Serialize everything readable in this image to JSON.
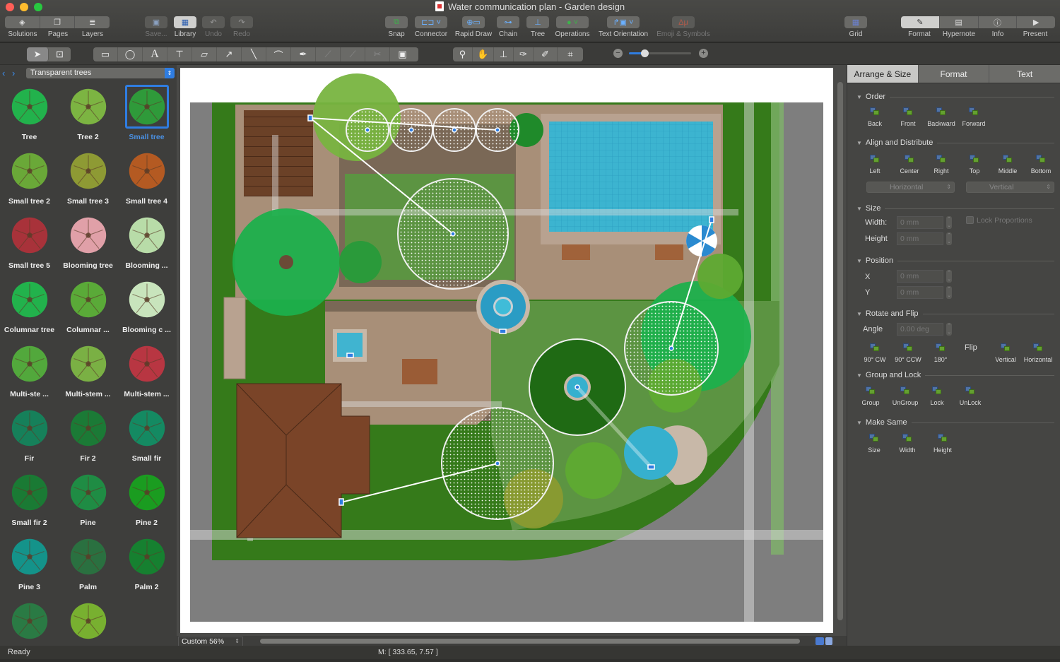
{
  "window": {
    "title": "Water communication plan - Garden design",
    "controls": [
      "close",
      "minimize",
      "zoom"
    ]
  },
  "toolbar": {
    "left_segment": [
      {
        "label": "Solutions",
        "icon": "solutions-icon"
      },
      {
        "label": "Pages",
        "icon": "pages-icon"
      },
      {
        "label": "Layers",
        "icon": "layers-icon"
      }
    ],
    "save": {
      "label": "Save...",
      "enabled": false
    },
    "library": {
      "label": "Library",
      "active": true
    },
    "undo": {
      "label": "Undo",
      "enabled": false
    },
    "redo": {
      "label": "Redo",
      "enabled": false
    },
    "snap": {
      "label": "Snap"
    },
    "connector": {
      "label": "Connector"
    },
    "rapid_draw": {
      "label": "Rapid Draw"
    },
    "chain": {
      "label": "Chain"
    },
    "tree": {
      "label": "Tree"
    },
    "operations": {
      "label": "Operations"
    },
    "text_orientation": {
      "label": "Text Orientation"
    },
    "emoji": {
      "label": "Emoji & Symbols",
      "enabled": false
    },
    "grid": {
      "label": "Grid"
    },
    "right_segment": [
      {
        "label": "Format",
        "icon": "palette-icon",
        "active": true
      },
      {
        "label": "Hypernote",
        "icon": "hypernote-icon"
      },
      {
        "label": "Info",
        "icon": "info-icon"
      },
      {
        "label": "Present",
        "icon": "present-icon"
      }
    ]
  },
  "drawing_tools": {
    "select": [
      "pointer-tool",
      "text-box-select-tool"
    ],
    "shapes": [
      "rectangle-tool",
      "ellipse-tool",
      "text-tool",
      "text-block-tool",
      "callout-tool",
      "arrow-line-tool",
      "line-tool",
      "arc-tool",
      "pen-tool",
      "edit-points-tool",
      "add-point-tool",
      "delete-point-tool",
      "image-tool"
    ],
    "view": [
      "zoom-tool",
      "pan-tool",
      "stamp-tool",
      "eyedropper-tool",
      "format-painter-tool",
      "crop-tool"
    ],
    "zoom_slider_value": 0.25
  },
  "library": {
    "selected": "Transparent trees",
    "items": [
      {
        "label": "Tree",
        "color": "#22b24c"
      },
      {
        "label": "Tree 2",
        "color": "#7cb442"
      },
      {
        "label": "Small tree",
        "color": "#2f9a3a",
        "selected": true
      },
      {
        "label": "Small tree 2",
        "color": "#6aa838"
      },
      {
        "label": "Small tree 3",
        "color": "#8e9a34"
      },
      {
        "label": "Small tree 4",
        "color": "#b45a22"
      },
      {
        "label": "Small tree 5",
        "color": "#a8323a"
      },
      {
        "label": "Blooming tree",
        "color": "#e0a0a8"
      },
      {
        "label": "Blooming ...",
        "color": "#b8dca8"
      },
      {
        "label": "Columnar tree",
        "color": "#22b24c"
      },
      {
        "label": "Columnar ...",
        "color": "#5aaa38"
      },
      {
        "label": "Blooming c ...",
        "color": "#c8e4bc"
      },
      {
        "label": "Multi-ste ...",
        "color": "#52a83c"
      },
      {
        "label": "Multi-stem ...",
        "color": "#7ab044"
      },
      {
        "label": "Multi-stem ...",
        "color": "#b83642"
      },
      {
        "label": "Fir",
        "color": "#16805a"
      },
      {
        "label": "Fir 2",
        "color": "#1b7a36"
      },
      {
        "label": "Small fir",
        "color": "#148a62"
      },
      {
        "label": "Small fir 2",
        "color": "#1a7a34"
      },
      {
        "label": "Pine",
        "color": "#1f8c44"
      },
      {
        "label": "Pine 2",
        "color": "#1a9c20"
      },
      {
        "label": "Pine 3",
        "color": "#14938a"
      },
      {
        "label": "Palm",
        "color": "#2a7040"
      },
      {
        "label": "Palm 2",
        "color": "#168030"
      },
      {
        "label": "",
        "color": "#2a7a44"
      },
      {
        "label": "",
        "color": "#78b030"
      }
    ]
  },
  "canvas": {
    "zoom_label": "Custom 56%",
    "mouse_position": "M: [ 333.65, 7.57 ]",
    "colors": {
      "road": "#7e7e7e",
      "lawn_dark": "#357a1a",
      "lawn": "#5c9442",
      "paving": "#a88f78",
      "path_dark": "#7a6856",
      "pool": "#3cb4d0",
      "roof": "#7a4428"
    }
  },
  "status": {
    "text": "Ready"
  },
  "right_panel": {
    "tabs": [
      {
        "label": "Arrange & Size",
        "active": true
      },
      {
        "label": "Format"
      },
      {
        "label": "Text"
      }
    ],
    "order": {
      "title": "Order",
      "buttons": [
        "Back",
        "Front",
        "Backward",
        "Forward"
      ]
    },
    "align": {
      "title": "Align and Distribute",
      "buttons": [
        "Left",
        "Center",
        "Right",
        "Top",
        "Middle",
        "Bottom"
      ],
      "horizontal": "Horizontal",
      "vertical": "Vertical"
    },
    "size": {
      "title": "Size",
      "width_label": "Width:",
      "width_value": "0 mm",
      "height_label": "Height",
      "height_value": "0 mm",
      "lock_label": "Lock Proportions",
      "lock_checked": false
    },
    "position": {
      "title": "Position",
      "x_label": "X",
      "x_value": "0 mm",
      "y_label": "Y",
      "y_value": "0 mm"
    },
    "rotate": {
      "title": "Rotate and Flip",
      "angle_label": "Angle",
      "angle_value": "0.00 deg",
      "buttons": [
        "90° CW",
        "90° CCW",
        "180°"
      ],
      "flip_label": "Flip",
      "flip_buttons": [
        "Vertical",
        "Horizontal"
      ]
    },
    "group": {
      "title": "Group and Lock",
      "buttons": [
        "Group",
        "UnGroup",
        "Lock",
        "UnLock"
      ]
    },
    "make_same": {
      "title": "Make Same",
      "buttons": [
        "Size",
        "Width",
        "Height"
      ]
    }
  }
}
